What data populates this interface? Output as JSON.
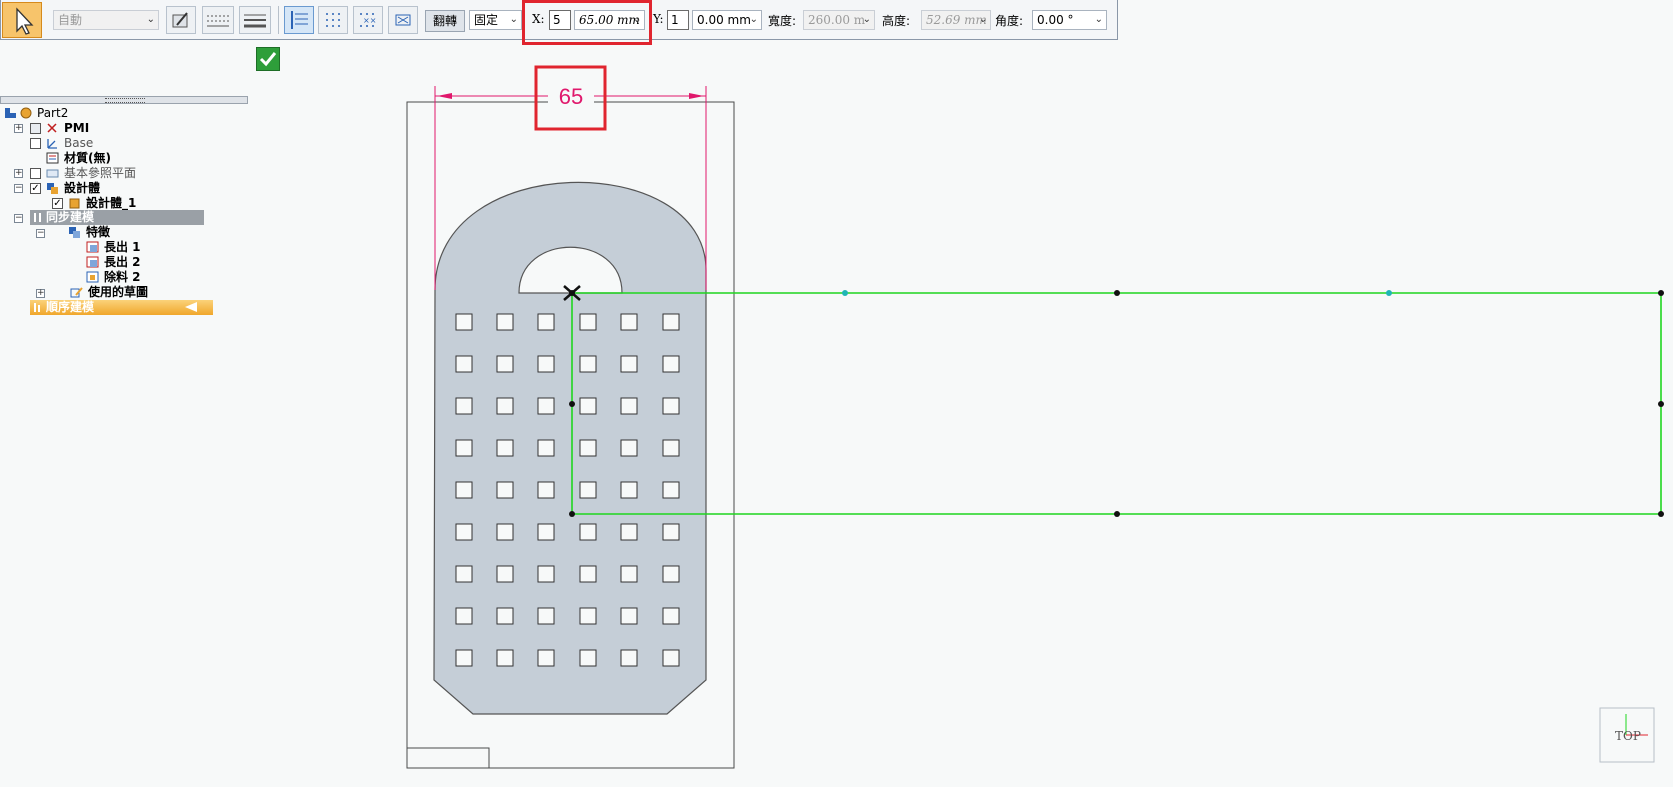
{
  "toolbar": {
    "mode_value": "自動",
    "rotate_label": "翻轉",
    "fixed_value": "固定",
    "x_label": "X:",
    "x_small_value": "5",
    "x_value": "65.00 mm",
    "y_label": "Y:",
    "y_small_value": "1",
    "y_value": "0.00 mm",
    "width_label": "寬度:",
    "width_value": "260.00 m",
    "height_label": "高度:",
    "height_value": "52.69 mm",
    "angle_label": "角度:",
    "angle_value": "0.00 °"
  },
  "tree": {
    "root": "Part2",
    "pmi": "PMI",
    "base": "Base",
    "material": "材質(無)",
    "ref_planes": "基本參照平面",
    "design_body": "設計體",
    "design_body_1": "設計體_1",
    "sync_modeling": "同步建模",
    "features": "特徵",
    "protrude_1": "長出 1",
    "protrude_2": "長出 2",
    "cutout_2": "除料 2",
    "used_sketches": "使用的草圖",
    "ordered_modeling": "順序建模"
  },
  "canvas": {
    "dimension_value": "65",
    "view_label": "TOP"
  },
  "colors": {
    "accent_orange": "#f7c46b",
    "highlight_red": "#e0252f",
    "sketch_green": "#1fd61f",
    "dimension_magenta": "#e0186c",
    "part_fill": "#c5ced7"
  }
}
